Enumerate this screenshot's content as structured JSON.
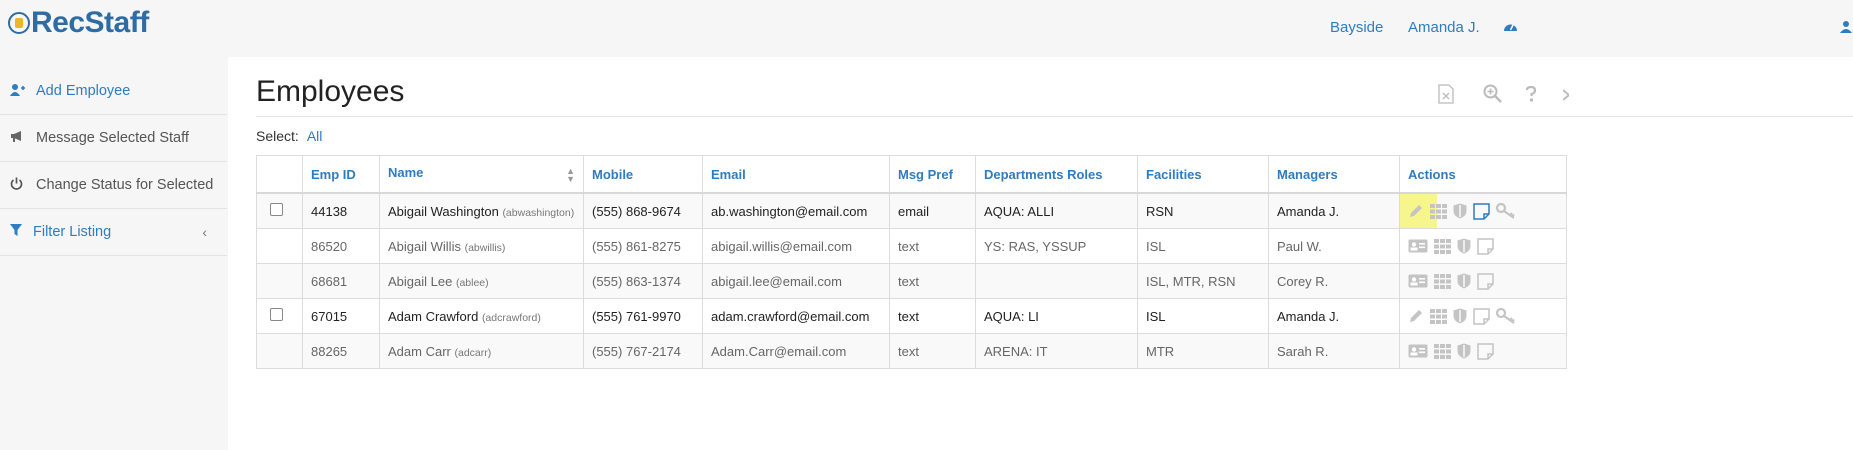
{
  "app": {
    "logo_text": "RecStaff"
  },
  "topnav": {
    "location": "Bayside",
    "user": "Amanda J."
  },
  "sidebar": {
    "items": [
      {
        "label": "Add Employee"
      },
      {
        "label": "Message Selected Staff"
      },
      {
        "label": "Change Status for Selected"
      },
      {
        "label": "Filter Listing"
      }
    ]
  },
  "page": {
    "title": "Employees"
  },
  "select": {
    "label": "Select:",
    "all": "All"
  },
  "table": {
    "columns": [
      "Emp ID",
      "Name",
      "Mobile",
      "Email",
      "Msg Pref",
      "Departments Roles",
      "Facilities",
      "Managers",
      "Actions"
    ],
    "rows": [
      {
        "active": true,
        "emp_id": "44138",
        "name": "Abigail Washington",
        "username": "(abwashington)",
        "mobile": "(555) 868-9674",
        "email": "ab.washington@email.com",
        "msg_pref": "email",
        "dept_roles": "AQUA: ALLI",
        "facilities": "RSN",
        "manager": "Amanda J."
      },
      {
        "active": false,
        "emp_id": "86520",
        "name": "Abigail Willis",
        "username": "(abwillis)",
        "mobile": "(555) 861-8275",
        "email": "abigail.willis@email.com",
        "msg_pref": "text",
        "dept_roles": "YS: RAS, YSSUP",
        "facilities": "ISL",
        "manager": "Paul W."
      },
      {
        "active": false,
        "emp_id": "68681",
        "name": "Abigail Lee",
        "username": "(ablee)",
        "mobile": "(555) 863-1374",
        "email": "abigail.lee@email.com",
        "msg_pref": "text",
        "dept_roles": "",
        "facilities": "ISL, MTR, RSN",
        "manager": "Corey R."
      },
      {
        "active": true,
        "emp_id": "67015",
        "name": "Adam Crawford",
        "username": "(adcrawford)",
        "mobile": "(555) 761-9970",
        "email": "adam.crawford@email.com",
        "msg_pref": "text",
        "dept_roles": "AQUA: LI",
        "facilities": "ISL",
        "manager": "Amanda J."
      },
      {
        "active": false,
        "emp_id": "88265",
        "name": "Adam Carr",
        "username": "(adcarr)",
        "mobile": "(555) 767-2174",
        "email": "Adam.Carr@email.com",
        "msg_pref": "text",
        "dept_roles": "ARENA: IT",
        "facilities": "MTR",
        "manager": "Sarah R."
      }
    ]
  },
  "colors": {
    "accent": "#2e7cc1",
    "highlight": "#f6f67a"
  }
}
